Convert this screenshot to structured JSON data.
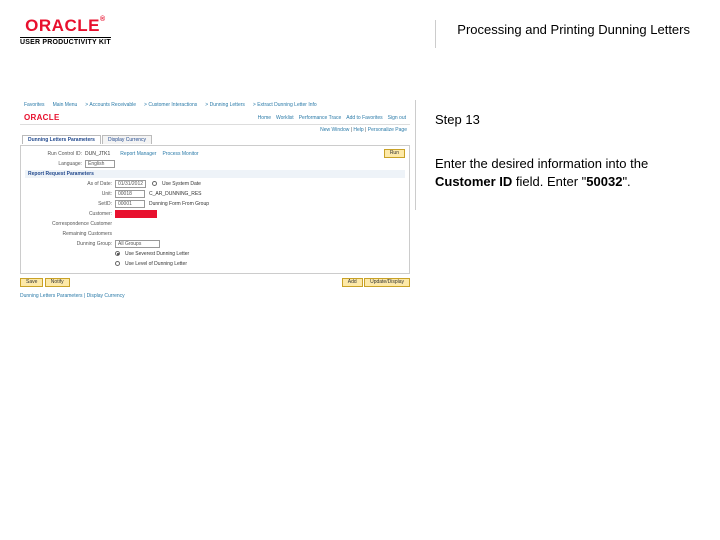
{
  "header": {
    "brand": "ORACLE",
    "brand_sub": "USER PRODUCTIVITY KIT",
    "lesson_title": "Processing and Printing Dunning Letters"
  },
  "right": {
    "step": "Step 13",
    "instr_part1": "Enter the desired information into the ",
    "instr_bold1": "Customer ID",
    "instr_part2": " field. Enter \"",
    "instr_bold2": "50032",
    "instr_part3": "\"."
  },
  "app": {
    "menu": {
      "m1": "Favorites",
      "m2": "Main Menu",
      "m3": "Accounts Receivable",
      "m4": "Customer Interactions",
      "m5": "Dunning Letters",
      "m6": "Extract Dunning Letter Info"
    },
    "brand2": "ORACLE",
    "top_links": {
      "l1": "Home",
      "l2": "Worklist",
      "l3": "Performance Trace",
      "l4": "Add to Favorites",
      "l5": "Sign out"
    },
    "subbar": {
      "s1": "New Window",
      "s2": "Help",
      "s3": "Personalize Page"
    },
    "tabs": {
      "t1": "Dunning Letters Parameters",
      "t2": "Display Currency"
    },
    "run_btn": "Run",
    "run_control": {
      "label": "Run Control ID:",
      "value": "DUN_JTK1",
      "rm": "Report Manager",
      "pm": "Process Monitor"
    },
    "language": {
      "label": "Language:",
      "value": "English"
    },
    "report_hdr": "Report Request Parameters",
    "as_of": {
      "label": "As of Date:",
      "value": "01/31/2012",
      "opt": "Use System Date"
    },
    "unit": {
      "label": "Unit:",
      "value": "00018",
      "look": "C_AR_DUNNING_RES"
    },
    "setid": {
      "label": "SetID:",
      "value": "00001",
      "hint": "Dunning Form From Group"
    },
    "customer": {
      "label": "Customer:"
    },
    "corr_cust": {
      "label": "Correspondence Customer"
    },
    "remain_cust": {
      "label": "Remaining Customers"
    },
    "dunning_group": {
      "label": "Dunning Group:",
      "value": "All Groups"
    },
    "radio1": "Use Severest Dunning Letter",
    "radio2": "Use Level of Dunning Letter",
    "footer": {
      "save": "Save",
      "notify": "Notify",
      "add": "Add",
      "update": "Update/Display"
    },
    "breadcrumb": "Dunning Letters Parameters | Display Currency"
  }
}
